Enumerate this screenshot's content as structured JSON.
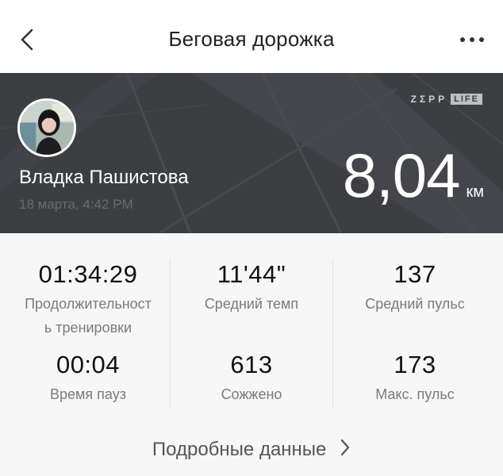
{
  "header": {
    "title": "Беговая дорожка"
  },
  "brand": {
    "zepp": "ZΣPP",
    "life": "LIFE"
  },
  "user": {
    "name": "Владка Пашистова",
    "date": "18 марта, 4:42 PM"
  },
  "distance": {
    "value": "8,04",
    "unit": "км"
  },
  "stats": [
    {
      "value": "01:34:29",
      "label": "Продолжительност\nь тренировки"
    },
    {
      "value": "11'44\"",
      "label": "Средний темп"
    },
    {
      "value": "137",
      "label": "Средний пульс"
    },
    {
      "value": "00:04",
      "label": "Время пауз"
    },
    {
      "value": "613",
      "label": "Сожжено"
    },
    {
      "value": "173",
      "label": "Макс. пульс"
    }
  ],
  "details": {
    "label": "Подробные данные"
  },
  "icons": {
    "back": "chevron-left-icon",
    "more": "more-dots-icon",
    "details": "chevron-right-icon"
  },
  "colors": {
    "hero_background": "#3d3e42",
    "stats_background": "#f7f7f7"
  }
}
